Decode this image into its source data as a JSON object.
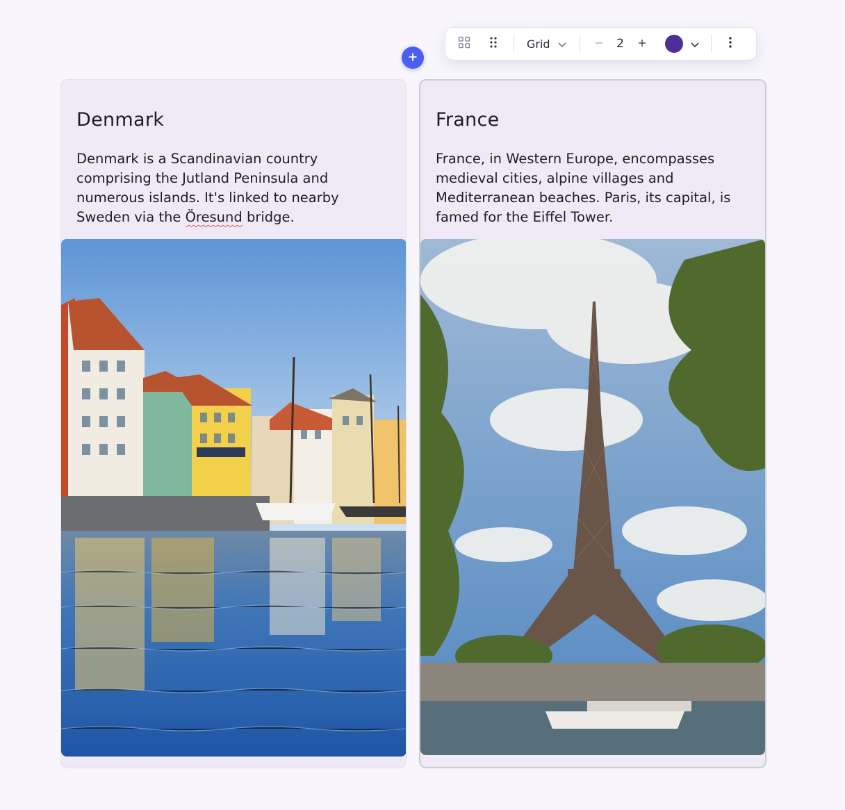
{
  "toolbar": {
    "layout_label": "Grid",
    "columns_value": "2",
    "selected_color": "#4e2d96",
    "icons": [
      "grid-view-icon",
      "drag-handle-icon",
      "chevron-down-icon",
      "minus-icon",
      "plus-icon",
      "chevron-down-icon",
      "more-vertical-icon"
    ]
  },
  "add_button": {
    "icon": "plus-icon",
    "color": "#4a5ff0"
  },
  "cards": [
    {
      "title": "Denmark",
      "description_before": "Denmark is a Scandinavian country comprising the Jutland Peninsula and numerous islands. It's linked to nearby Sweden via the ",
      "description_flagged": "Öresund",
      "description_after": " bridge.",
      "image": "Nyhavn harbour with colourful houses and boats"
    },
    {
      "title": "France",
      "description": "France, in Western Europe, encompasses medieval cities, alpine villages and Mediterranean beaches. Paris, its capital, is famed for the Eiffel Tower.",
      "image": "Eiffel Tower seen from the Seine with trees and clouds"
    }
  ]
}
